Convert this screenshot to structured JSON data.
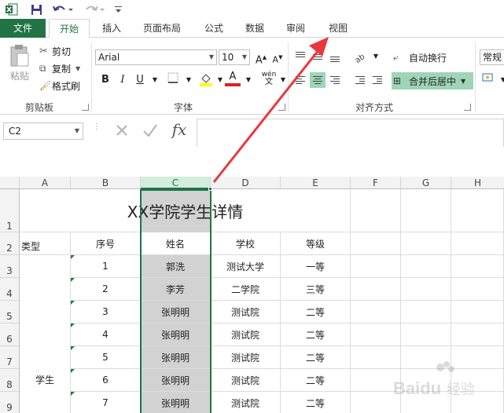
{
  "quick_access": {
    "app_icon": "excel-logo-icon",
    "save_icon": "save-icon",
    "undo_icon": "undo-icon",
    "redo_icon": "redo-icon"
  },
  "tabs": [
    {
      "label": "文件"
    },
    {
      "label": "开始"
    },
    {
      "label": "插入"
    },
    {
      "label": "页面布局"
    },
    {
      "label": "公式"
    },
    {
      "label": "数据"
    },
    {
      "label": "审阅"
    },
    {
      "label": "视图"
    }
  ],
  "ribbon": {
    "clipboard": {
      "paste": "粘贴",
      "cut": "剪切",
      "copy": "复制",
      "format_painter": "格式刷",
      "label": "剪贴板"
    },
    "font": {
      "name": "Arial",
      "size": "10",
      "label": "字体",
      "bold": "B",
      "italic": "I",
      "underline": "U",
      "grow": "A",
      "shrink": "A",
      "phonetic": "wén",
      "font_color": "A"
    },
    "alignment": {
      "wrap": "自动换行",
      "merge": "合并后居中",
      "label": "对齐方式"
    },
    "number": {
      "format": "常规"
    }
  },
  "formula_bar": {
    "name_box": "C2",
    "fx": "fx"
  },
  "sheet": {
    "columns": [
      "A",
      "B",
      "C",
      "D",
      "E",
      "F",
      "G",
      "H"
    ],
    "rows": [
      "1",
      "2",
      "3",
      "4",
      "5",
      "6",
      "7",
      "8",
      "9"
    ],
    "title": "XX学院学生详情",
    "headers": {
      "a": "类型",
      "b": "序号",
      "c": "姓名",
      "d": "学校",
      "e": "等级"
    },
    "merged_type": "学生",
    "records": [
      {
        "no": "1",
        "name": "郭洗",
        "school": "测试大学",
        "grade": "一等"
      },
      {
        "no": "2",
        "name": "李芳",
        "school": "二学院",
        "grade": "三等"
      },
      {
        "no": "3",
        "name": "张明明",
        "school": "测试院",
        "grade": "二等"
      },
      {
        "no": "4",
        "name": "张明明",
        "school": "测试院",
        "grade": "二等"
      },
      {
        "no": "5",
        "name": "张明明",
        "school": "测试院",
        "grade": "二等"
      },
      {
        "no": "6",
        "name": "张明明",
        "school": "测试院",
        "grade": "二等"
      },
      {
        "no": "7",
        "name": "张明明",
        "school": "测试院",
        "grade": "二等"
      }
    ]
  },
  "colors": {
    "accent": "#217346",
    "selection": "#d2d2d2",
    "arrow": "#e8383d"
  }
}
